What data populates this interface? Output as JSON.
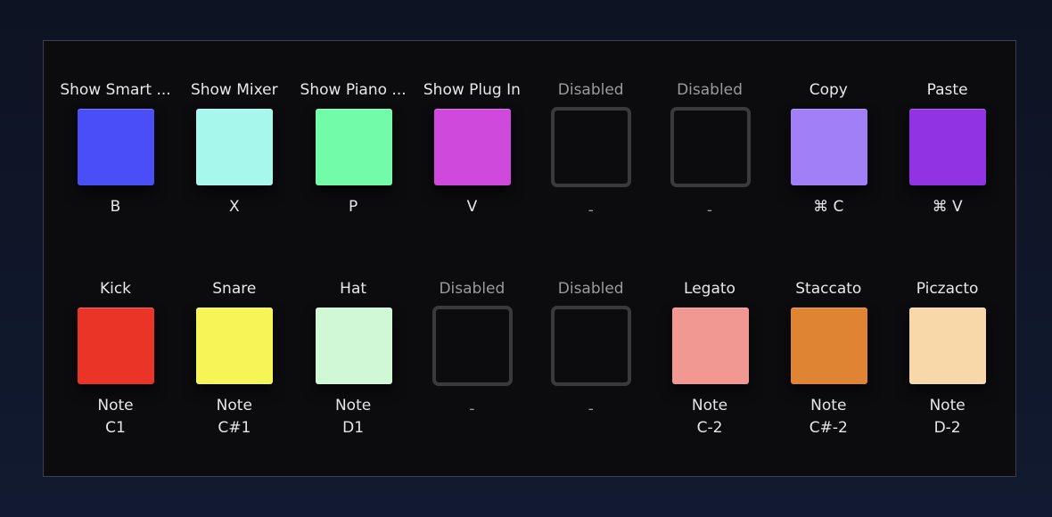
{
  "rows": [
    {
      "cells": [
        {
          "label": "Show Smart ...",
          "sub": "B",
          "color": "#4a4ef7",
          "disabled": false
        },
        {
          "label": "Show Mixer",
          "sub": "X",
          "color": "#a8f7ec",
          "disabled": false
        },
        {
          "label": "Show Piano ...",
          "sub": "P",
          "color": "#72fcaa",
          "disabled": false
        },
        {
          "label": "Show Plug In",
          "sub": "V",
          "color": "#cf4adc",
          "disabled": false
        },
        {
          "label": "Disabled",
          "sub": "-",
          "color": "",
          "disabled": true
        },
        {
          "label": "Disabled",
          "sub": "-",
          "color": "",
          "disabled": true
        },
        {
          "label": "Copy",
          "sub": "⌘ C",
          "color": "#a07ff7",
          "disabled": false
        },
        {
          "label": "Paste",
          "sub": "⌘ V",
          "color": "#9132e3",
          "disabled": false
        }
      ]
    },
    {
      "cells": [
        {
          "label": "Kick",
          "sub": "Note\nC1",
          "color": "#ea3427",
          "disabled": false
        },
        {
          "label": "Snare",
          "sub": "Note\nC#1",
          "color": "#f5f558",
          "disabled": false
        },
        {
          "label": "Hat",
          "sub": "Note\nD1",
          "color": "#d0f8d6",
          "disabled": false
        },
        {
          "label": "Disabled",
          "sub": "-",
          "color": "",
          "disabled": true
        },
        {
          "label": "Disabled",
          "sub": "-",
          "color": "",
          "disabled": true
        },
        {
          "label": "Legato",
          "sub": "Note\nC-2",
          "color": "#f09891",
          "disabled": false
        },
        {
          "label": "Staccato",
          "sub": "Note\nC#-2",
          "color": "#df8433",
          "disabled": false
        },
        {
          "label": "Piczacto",
          "sub": "Note\nD-2",
          "color": "#f8d7a8",
          "disabled": false
        }
      ]
    }
  ]
}
